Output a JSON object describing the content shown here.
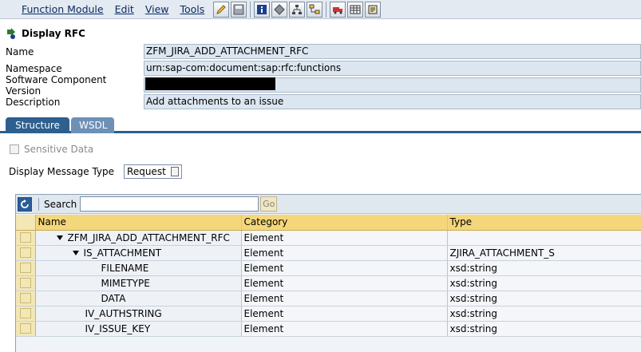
{
  "menu": {
    "items": [
      {
        "label": "Function Module",
        "underline": "F"
      },
      {
        "label": "Edit",
        "underline": "E"
      },
      {
        "label": "View",
        "underline": "V"
      },
      {
        "label": "Tools",
        "underline": "T"
      }
    ]
  },
  "title": "Display RFC",
  "form": {
    "name_label": "Name",
    "name_value": "ZFM_JIRA_ADD_ATTACHMENT_RFC",
    "namespace_label": "Namespace",
    "namespace_value": "urn:sap-com:document:sap:rfc:functions",
    "scv_label": "Software Component Version",
    "description_label": "Description",
    "description_value": "Add attachments to an issue"
  },
  "tabs": {
    "structure": "Structure",
    "wsdl": "WSDL"
  },
  "sensitive_data": "Sensitive Data",
  "message_type": {
    "label": "Display Message Type",
    "value": "Request"
  },
  "tree": {
    "search_label": "Search",
    "go_label": "Go",
    "columns": {
      "name": "Name",
      "category": "Category",
      "type": "Type"
    },
    "rows": [
      {
        "name": "ZFM_JIRA_ADD_ATTACHMENT_RFC",
        "category": "Element",
        "type": ""
      },
      {
        "name": "IS_ATTACHMENT",
        "category": "Element",
        "type": "ZJIRA_ATTACHMENT_S"
      },
      {
        "name": "FILENAME",
        "category": "Element",
        "type": "xsd:string"
      },
      {
        "name": "MIMETYPE",
        "category": "Element",
        "type": "xsd:string"
      },
      {
        "name": "DATA",
        "category": "Element",
        "type": "xsd:string"
      },
      {
        "name": "IV_AUTHSTRING",
        "category": "Element",
        "type": "xsd:string"
      },
      {
        "name": "IV_ISSUE_KEY",
        "category": "Element",
        "type": "xsd:string"
      }
    ]
  },
  "colors": {
    "tab_active": "#2d5f8f",
    "header_yellow": "#f5d77b"
  }
}
